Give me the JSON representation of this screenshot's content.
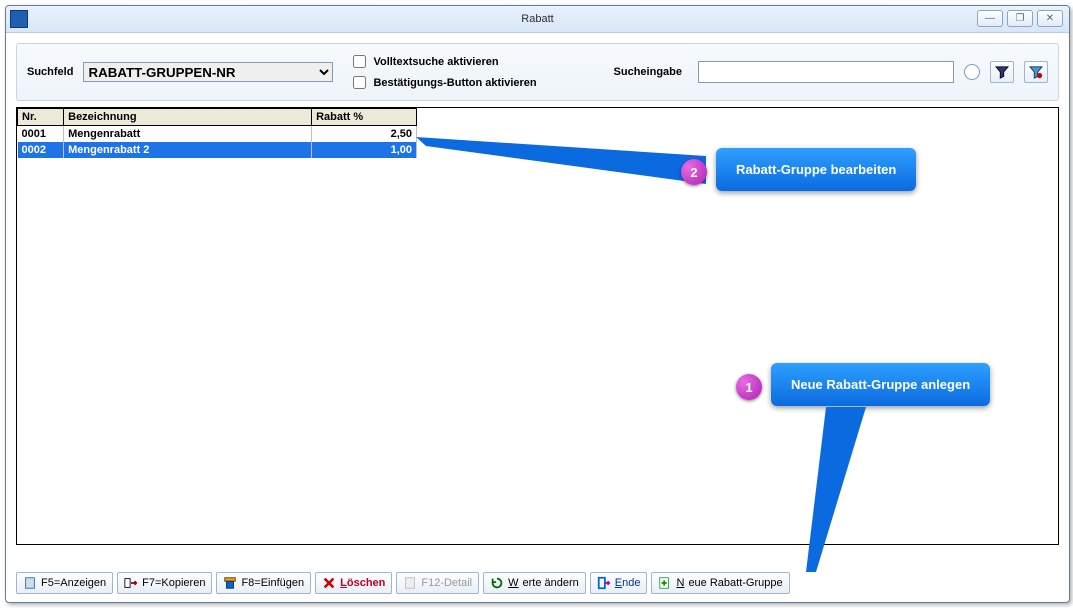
{
  "window": {
    "title": "Rabatt"
  },
  "search": {
    "label": "Suchfeld",
    "dropdown_value": "RABATT-GRUPPEN-NR",
    "chk_fulltext": "Volltextsuche aktivieren",
    "chk_confirm": "Bestätigungs-Button aktivieren",
    "input_label": "Sucheingabe",
    "input_value": ""
  },
  "grid": {
    "headers": {
      "nr": "Nr.",
      "bez": "Bezeichnung",
      "rab": "Rabatt %"
    },
    "rows": [
      {
        "nr": "0001",
        "bez": "Mengenrabatt",
        "rab": "2,50",
        "selected": false
      },
      {
        "nr": "0002",
        "bez": "Mengenrabatt 2",
        "rab": "1,00",
        "selected": true
      }
    ]
  },
  "toolbar": {
    "anzeigen": "F5=Anzeigen",
    "kopieren": "F7=Kopieren",
    "einfuegen": "F8=Einfügen",
    "loeschen_u": "L",
    "loeschen_rest": "öschen",
    "detail": "F12-Detail",
    "werte_u": "W",
    "werte_rest": "erte ändern",
    "ende_u": "E",
    "ende_rest": "nde",
    "neue_u": "N",
    "neue_rest": "eue Rabatt-Gruppe"
  },
  "callouts": {
    "c1": {
      "num": "1",
      "text": "Neue Rabatt-Gruppe anlegen"
    },
    "c2": {
      "num": "2",
      "text": "Rabatt-Gruppe bearbeiten"
    }
  }
}
